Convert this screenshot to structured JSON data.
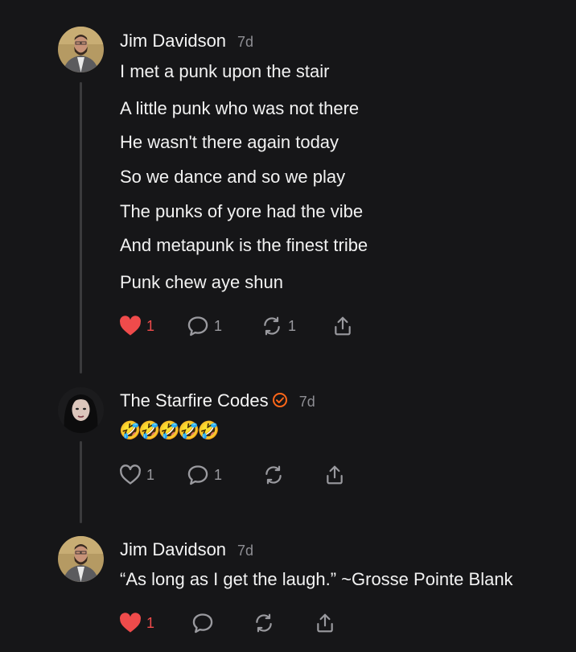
{
  "comments": [
    {
      "author": "Jim Davidson",
      "time": "7d",
      "lines": [
        "I met a punk upon the stair",
        "A little punk who was not there",
        "He wasn't there again today",
        "So we dance and so we play",
        "The punks of yore had the vibe",
        "And metapunk is the finest tribe",
        "Punk chew aye shun"
      ],
      "likes": "1",
      "replies": "1",
      "restacks": "1",
      "liked": true
    },
    {
      "author": "The Starfire Codes",
      "time": "7d",
      "verified": true,
      "text": "🤣🤣🤣🤣🤣",
      "likes": "1",
      "replies": "1",
      "liked": false
    },
    {
      "author": "Jim Davidson",
      "time": "7d",
      "text": "“As long as I get the laugh.” ~Grosse Pointe Blank",
      "likes": "1",
      "liked": true
    }
  ],
  "colors": {
    "background": "#161618",
    "like_active": "#ef4b4b",
    "verified_badge": "#ff6719",
    "muted": "#8e8e93"
  },
  "icons": [
    "heart-icon",
    "comment-icon",
    "restack-icon",
    "share-icon",
    "verified-badge-icon"
  ]
}
